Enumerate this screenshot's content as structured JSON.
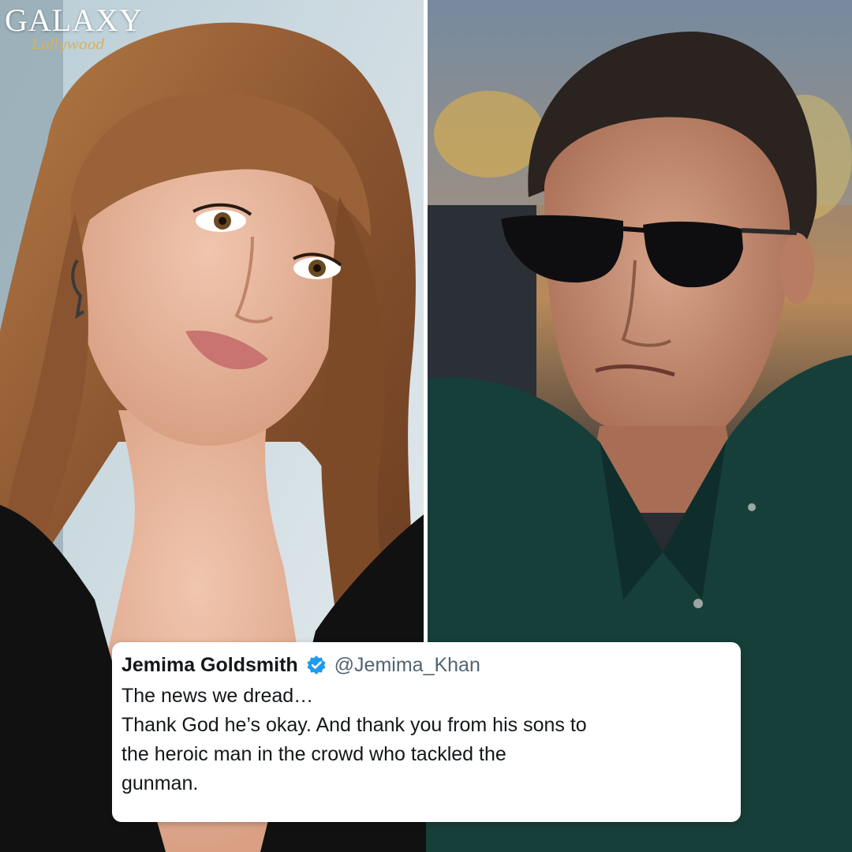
{
  "watermark": {
    "brand": "GALAXY",
    "sub": "Lollywood"
  },
  "tweet": {
    "name": "Jemima Goldsmith",
    "handle": "@Jemima_Khan",
    "lines": [
      "The news we dread…",
      "Thank God he’s okay. And thank you from his sons to",
      "the heroic man in the crowd who tackled the",
      "gunman."
    ],
    "verified_color": "#1d9bf0"
  },
  "colors": {
    "hair": "#9a5e33",
    "shirt_right": "#173f3a",
    "top_left": "#111111"
  }
}
